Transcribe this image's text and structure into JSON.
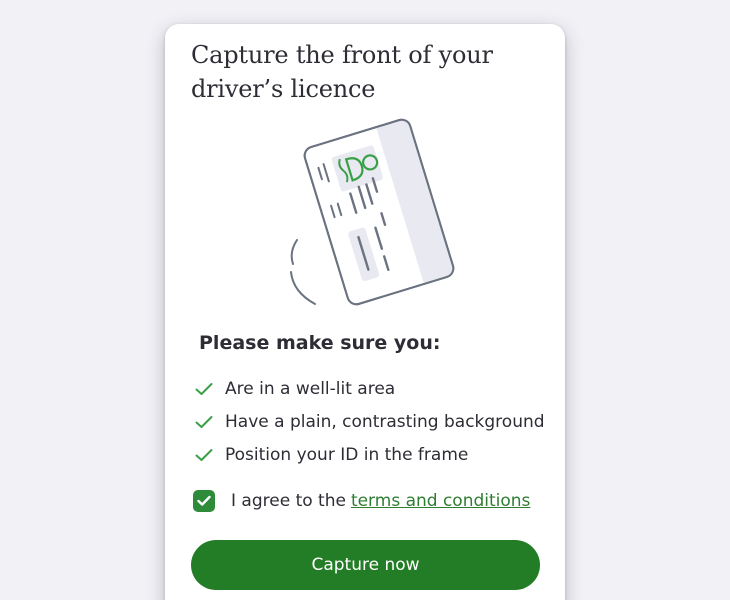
{
  "title": "Capture the front of your driver’s licence",
  "illustration": {
    "icon": "id-card-illustration",
    "accent_color": "#3aa047",
    "outline_color": "#6b7280",
    "card_fill": "#e9e9f2"
  },
  "checklist": {
    "heading": "Please make sure you:",
    "items": [
      "Are in a well-lit area",
      "Have a plain, contrasting background",
      "Position your ID in the frame"
    ],
    "check_color": "#3aa047"
  },
  "agreement": {
    "checked": true,
    "label": "I agree to the",
    "link_text": "terms and conditions"
  },
  "capture_button": {
    "label": "Capture now",
    "color": "#237d26"
  }
}
